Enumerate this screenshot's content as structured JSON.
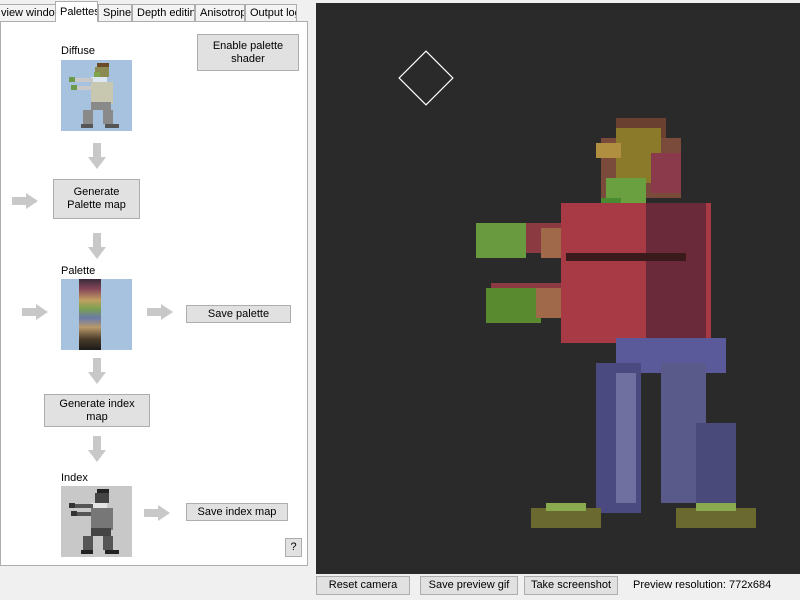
{
  "tabs": [
    {
      "label": "view window",
      "active": false
    },
    {
      "label": "Palettes",
      "active": true
    },
    {
      "label": "Spine",
      "active": false
    },
    {
      "label": "Depth editing",
      "active": false
    },
    {
      "label": "Anisotropy",
      "active": false
    },
    {
      "label": "Output log",
      "active": false
    }
  ],
  "palettes": {
    "diffuse_label": "Diffuse",
    "enable_shader_label": "Enable palette shader",
    "generate_palette_label": "Generate Palette map",
    "palette_label": "Palette",
    "save_palette_label": "Save palette",
    "generate_index_label": "Generate index map",
    "index_label": "Index",
    "save_index_label": "Save index map",
    "help_label": "?"
  },
  "bottom": {
    "reset_camera": "Reset camera",
    "save_gif": "Save preview gif",
    "take_screenshot": "Take screenshot",
    "preview_resolution": "Preview resolution: 772x684"
  },
  "colors": {
    "thumb_blue": "#a7c2de",
    "viewport_bg": "#2a2a2a",
    "arrow_gray": "#c8c8c8"
  }
}
